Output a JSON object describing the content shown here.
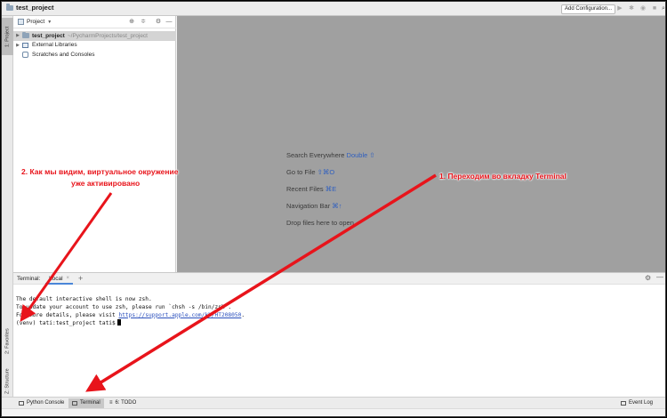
{
  "window": {
    "title": "test_project"
  },
  "toolbar": {
    "add_configuration": "Add Configuration..."
  },
  "left_strip": {
    "project_tab": "1: Project",
    "favorites_tab": "2: Favorites",
    "structure_tab": "Z: Structure"
  },
  "project_panel": {
    "title": "Project",
    "tree": [
      {
        "label": "test_project",
        "path": "~/PycharmProjects/test_project"
      },
      {
        "label": "External Libraries"
      },
      {
        "label": "Scratches and Consoles"
      }
    ]
  },
  "editor_tips": [
    {
      "text": "Search Everywhere",
      "key": "Double ⇧"
    },
    {
      "text": "Go to File",
      "key": "⇧⌘O"
    },
    {
      "text": "Recent Files",
      "key": "⌘E"
    },
    {
      "text": "Navigation Bar",
      "key": "⌘↑"
    },
    {
      "text": "Drop files here to open",
      "key": ""
    }
  ],
  "terminal": {
    "label": "Terminal:",
    "tab": "Local",
    "lines": {
      "l1": "The default interactive shell is now zsh.",
      "l2": "To update your account to use zsh, please run `chsh -s /bin/zsh`.",
      "l3_prefix": "For more details, please visit ",
      "l3_link": "https://support.apple.com/kb/HT208050",
      "l3_suffix": ".",
      "prompt": "(venv) tati:test_project tati$"
    }
  },
  "statusbar": {
    "python_console": "Python Console",
    "terminal": "Terminal",
    "todo": "6: TODO",
    "event_log": "Event Log"
  },
  "annotations": {
    "left_line1": "2. Как мы видим, виртуальное окружение",
    "left_line2": "уже активировано",
    "right": "1. Переходим во вкладку Terminal",
    "color": "#e8141b"
  }
}
